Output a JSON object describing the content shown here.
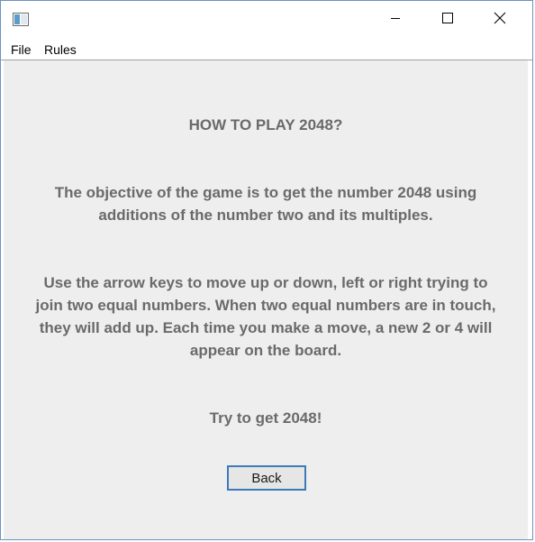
{
  "window": {
    "icon": "app-window-icon",
    "controls": {
      "minimize_icon": "minimize-icon",
      "maximize_icon": "maximize-icon",
      "close_icon": "close-icon"
    },
    "border_color": "#6e93c0"
  },
  "menubar": {
    "items": [
      {
        "label": "File"
      },
      {
        "label": "Rules"
      }
    ]
  },
  "rules_page": {
    "heading": "HOW TO PLAY 2048?",
    "objective": "The objective of the game is to get the number 2048 using additions of the number two and its multiples.",
    "instructions": "Use the arrow keys to move up or down, left or right trying to join two equal numbers.  When two equal numbers are in touch, they will add up. Each time you make a move, a new 2 or 4 will appear on the board.",
    "tagline": "Try to get 2048!",
    "back_label": "Back",
    "text_color": "#6a6a6a",
    "background_color": "#eeeeee",
    "button_border_color": "#3d7ab8"
  }
}
